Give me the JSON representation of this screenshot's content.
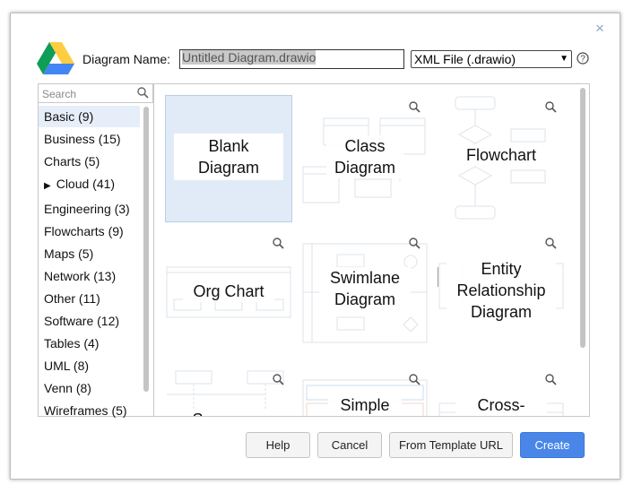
{
  "dialog": {
    "name_label": "Diagram Name:",
    "name_value": "Untitled Diagram.drawio",
    "file_type": "XML File (.drawio)",
    "close_glyph": "×",
    "help_icon": "help-circle-icon"
  },
  "search": {
    "placeholder": "Search"
  },
  "categories": [
    {
      "label": "Basic (9)"
    },
    {
      "label": "Business (15)"
    },
    {
      "label": "Charts (5)"
    },
    {
      "label": "Cloud (41)"
    },
    {
      "label": "Engineering (3)"
    },
    {
      "label": "Flowcharts (9)"
    },
    {
      "label": "Maps (5)"
    },
    {
      "label": "Network (13)"
    },
    {
      "label": "Other (11)"
    },
    {
      "label": "Software (12)"
    },
    {
      "label": "Tables (4)"
    },
    {
      "label": "UML (8)"
    },
    {
      "label": "Venn (8)"
    },
    {
      "label": "Wireframes (5)"
    }
  ],
  "templates": [
    {
      "line1": "Blank",
      "line2": "Diagram"
    },
    {
      "line1": "Class",
      "line2": "Diagram"
    },
    {
      "line1": "Flowchart"
    },
    {
      "line1": "Org Chart"
    },
    {
      "line1": "Swimlane",
      "line2": "Diagram"
    },
    {
      "line1": "Entity",
      "line2": "Relationship",
      "line3": "Diagram"
    },
    {
      "line1": "Sequence"
    },
    {
      "line1": "Simple"
    },
    {
      "line1": "Cross-"
    }
  ],
  "buttons": {
    "help": "Help",
    "cancel": "Cancel",
    "from_url": "From Template URL",
    "create": "Create"
  },
  "colors": {
    "accent": "#4a86e8",
    "selected_bg": "#e1ebf7",
    "logo_green": "#0f9d58",
    "logo_yellow": "#ffcd40",
    "logo_blue": "#4285f4"
  }
}
